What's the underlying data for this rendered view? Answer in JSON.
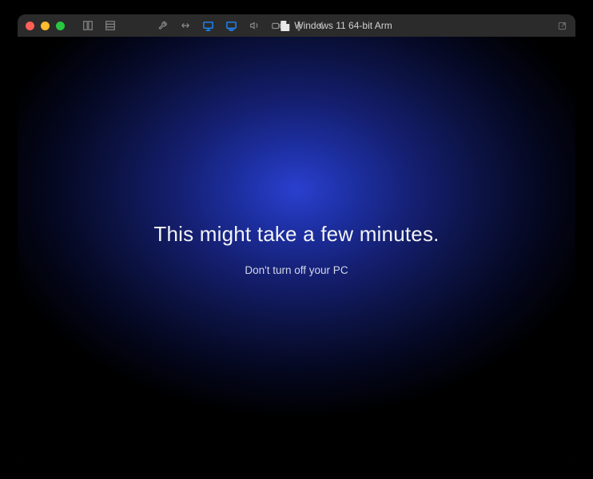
{
  "window": {
    "title": "Windows 11 64-bit Arm"
  },
  "icons": {
    "traffic_close": "close",
    "traffic_min": "minimize",
    "traffic_max": "maximize",
    "view_columns": "columns-icon",
    "view_list": "list-icon",
    "tool_wrench": "wrench-icon",
    "tool_resize": "resize-icon",
    "tool_display1": "display-icon",
    "tool_display2": "display-alt-icon",
    "tool_volume": "volume-icon",
    "tool_camera": "camera-icon",
    "tool_usb": "usb-icon",
    "tool_back": "back-icon",
    "tool_share": "send-icon"
  },
  "screen": {
    "heading": "This might take a few minutes.",
    "subtext": "Don't turn off your PC"
  }
}
